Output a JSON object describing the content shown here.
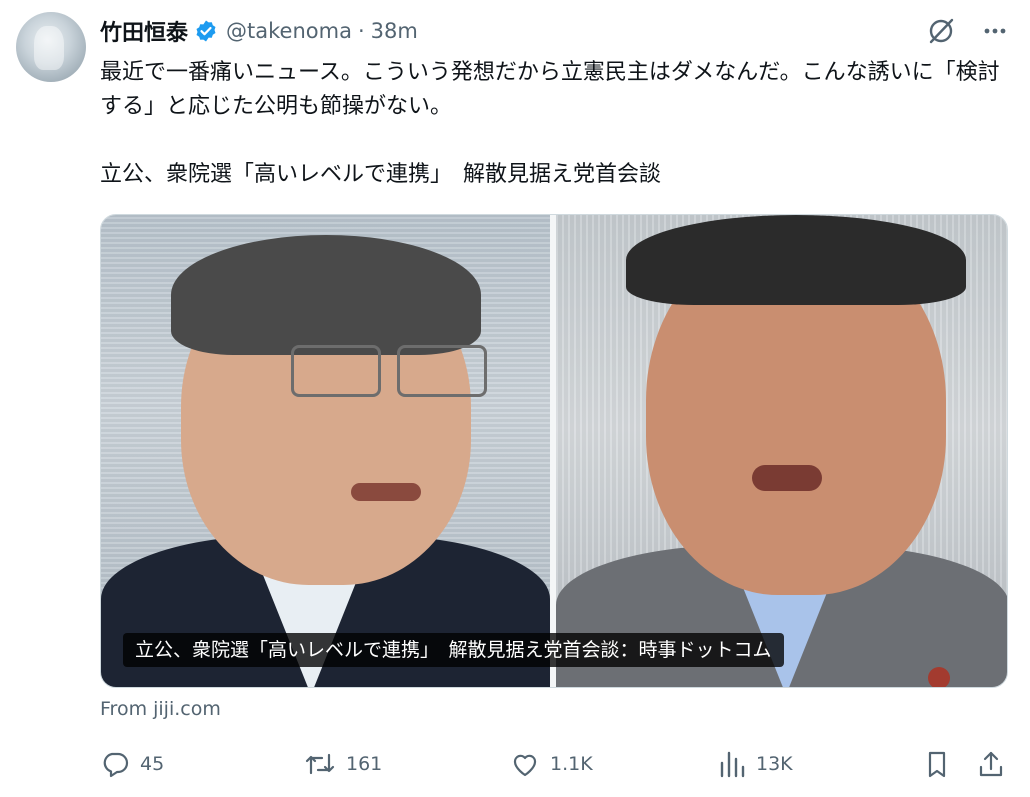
{
  "author": {
    "display_name": "竹田恒泰",
    "handle": "@takenoma",
    "separator": "·",
    "time": "38m",
    "verified_color": "#1d9bf0"
  },
  "tweet": {
    "text": "最近で一番痛いニュース。こういう発想だから立憲民主はダメなんだ。こんな誘いに「検討する」と応じた公明も節操がない。",
    "headline": "立公、衆院選「高いレベルで連携」　解散見据え党首会談"
  },
  "media": {
    "caption": "立公、衆院選「高いレベルで連携」　解散見据え党首会談：時事ドットコム",
    "source": "From jiji.com"
  },
  "actions": {
    "reply_count": "45",
    "repost_count": "161",
    "like_count": "1.1K",
    "view_count": "13K"
  },
  "icons": {
    "verified": "verified-badge-icon",
    "grok": "grok-icon",
    "more": "more-icon",
    "reply": "reply-icon",
    "repost": "repost-icon",
    "like": "like-icon",
    "views": "views-icon",
    "bookmark": "bookmark-icon",
    "share": "share-icon"
  }
}
